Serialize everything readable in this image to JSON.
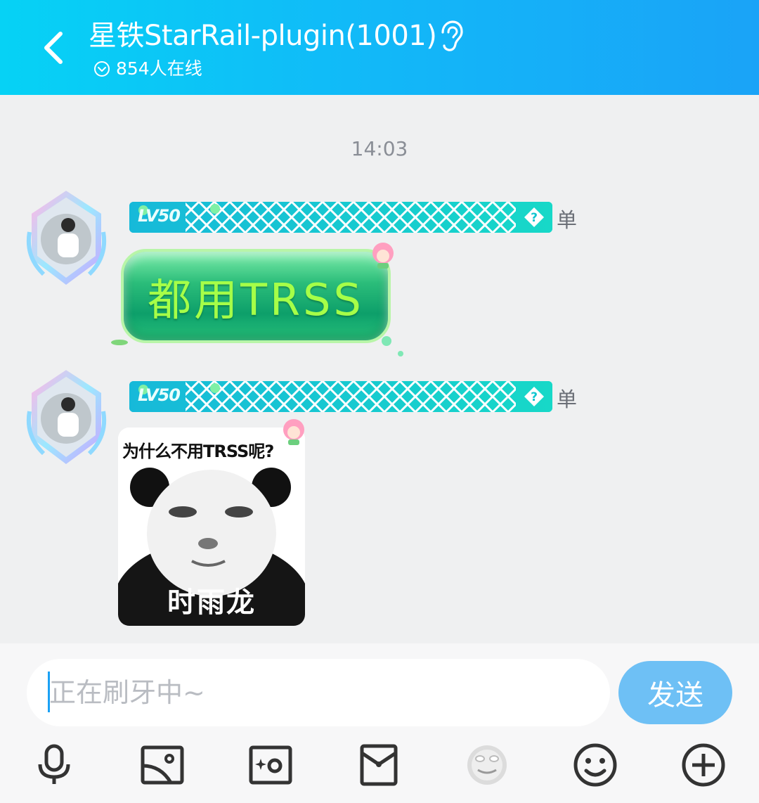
{
  "header": {
    "title": "星铁StarRail-plugin(1001)",
    "online_text": "854人在线",
    "icons": {
      "back": "chevron-left-icon",
      "listen": "ear-icon",
      "online_expand": "circle-chevron-down-icon"
    }
  },
  "chat": {
    "timestamp": "14:03",
    "messages": [
      {
        "sender_level": "LV50",
        "sender_tag": "单",
        "type": "text",
        "text": "都用TRSS"
      },
      {
        "sender_level": "LV50",
        "sender_tag": "单",
        "type": "sticker",
        "sticker_caption_top": "为什么不用TRSS呢?",
        "sticker_caption_bottom": "时雨龙"
      }
    ]
  },
  "composer": {
    "placeholder": "正在刷牙中~",
    "value": "",
    "send_label": "发送"
  },
  "toolbar": {
    "items": [
      "microphone-icon",
      "image-icon",
      "camera-icon",
      "red-packet-icon",
      "sticker-face-icon",
      "emoji-icon",
      "plus-icon"
    ]
  },
  "colors": {
    "header_start": "#06d2f5",
    "header_end": "#1aa3f7",
    "send_button": "#6ec0f5",
    "nameplate": "#10c9d2",
    "bubble_text": "#a6ff48"
  }
}
